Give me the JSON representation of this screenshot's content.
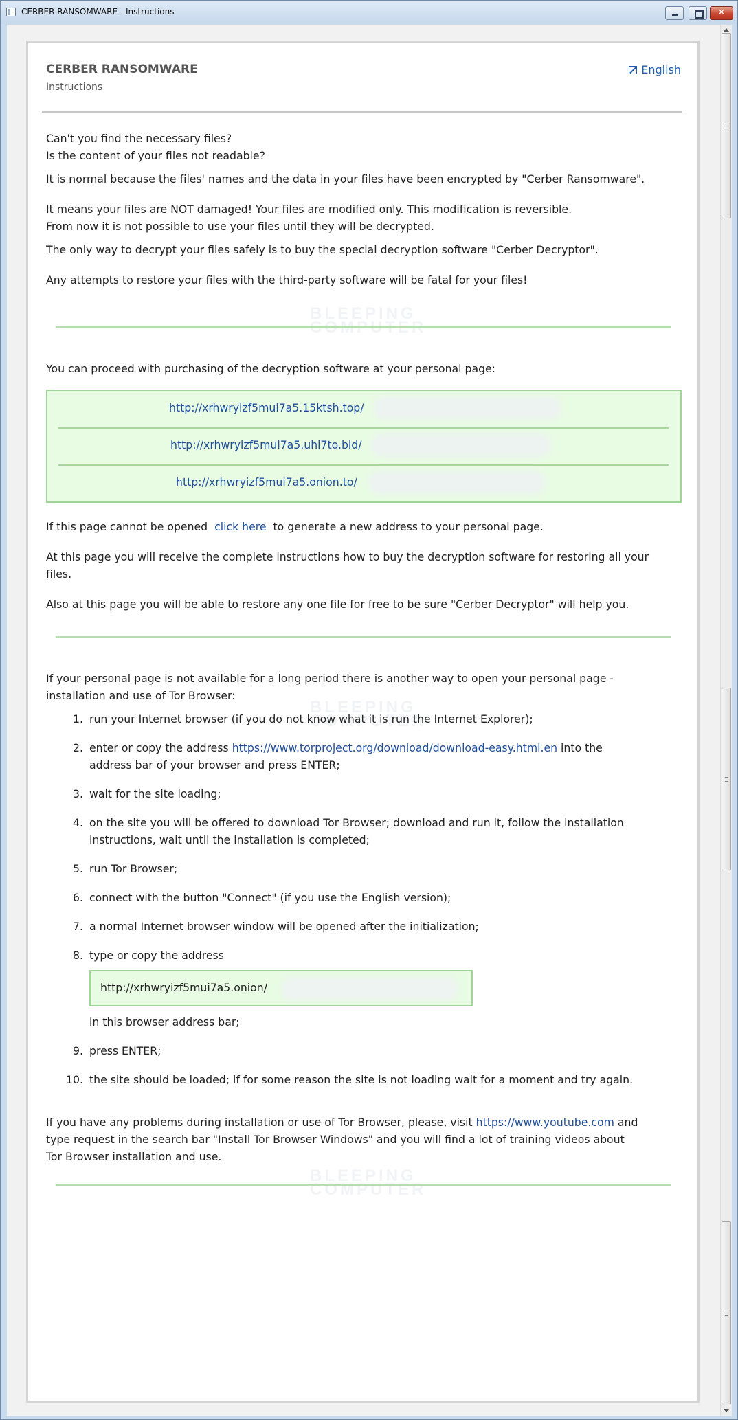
{
  "window": {
    "title": "CERBER RANSOMWARE - Instructions"
  },
  "header": {
    "title": "CERBER RANSOMWARE",
    "subtitle": "Instructions",
    "language": "English"
  },
  "intro": {
    "p1_line1": "Can't you find the necessary files?",
    "p1_line2": "Is the content of your files not readable?",
    "p2": "It is normal because the files' names and the data in your files have been encrypted by \"Cerber Ransomware\".",
    "p3_line1": "It means your files are NOT damaged! Your files are modified only. This modification is reversible.",
    "p3_line2": "From now it is not possible to use your files until they will be decrypted.",
    "p4": "The only way to decrypt your files safely is to buy the special decryption software \"Cerber Decryptor\".",
    "p5": "Any attempts to restore your files with the third-party software will be fatal for your files!"
  },
  "watermark": {
    "line1": "BLEEPING",
    "line2": "COMPUTER"
  },
  "purchase": {
    "intro": "You can proceed with purchasing of the decryption software at your personal page:",
    "urls": [
      "http://xrhwryizf5mui7a5.15ktsh.top/",
      "http://xrhwryizf5mui7a5.uhi7to.bid/",
      "http://xrhwryizf5mui7a5.onion.to/"
    ],
    "cannot_open_before": "If this page cannot be opened",
    "click_here": "click here",
    "cannot_open_after": "to generate a new address to your personal page.",
    "complete_line1": "At this page you will receive the complete instructions how to buy the decryption software for restoring all your",
    "complete_line2": "files.",
    "restore_free": "Also at this page you will be able to restore any one file for free to be sure \"Cerber Decryptor\" will help you."
  },
  "tor": {
    "intro_line1": "If your personal page is not available for a long period there is another way to open your personal page -",
    "intro_line2": "installation and use of Tor Browser:",
    "steps": [
      {
        "num": "1.",
        "text": "run your Internet browser (if you do not know what it is run the Internet Explorer);"
      },
      {
        "num": "2.",
        "before": "enter or copy the address",
        "link": "https://www.torproject.org/download/download-easy.html.en",
        "after": "into the",
        "line2": "address bar of your browser and press ENTER;"
      },
      {
        "num": "3.",
        "text": "wait for the site loading;"
      },
      {
        "num": "4.",
        "line1": "on the site you will be offered to download Tor Browser; download and run it, follow the installation",
        "line2": "instructions, wait until the installation is completed;"
      },
      {
        "num": "5.",
        "text": "run Tor Browser;"
      },
      {
        "num": "6.",
        "text": "connect with the button \"Connect\" (if you use the English version);"
      },
      {
        "num": "7.",
        "text": "a normal Internet browser window will be opened after the initialization;"
      },
      {
        "num": "8.",
        "text": "type or copy the address",
        "onion": "http://xrhwryizf5mui7a5.onion/",
        "after": "in this browser address bar;"
      },
      {
        "num": "9.",
        "text": "press ENTER;"
      },
      {
        "num": "10.",
        "text": "the site should be loaded; if for some reason the site is not loading wait for a moment and try again."
      }
    ],
    "help_before": "If you have any problems during installation or use of Tor Browser, please, visit",
    "help_link": "https://www.youtube.com",
    "help_after": "and",
    "help_line2": "type request in the search bar \"Install Tor Browser Windows\" and you will find a lot of training videos about",
    "help_line3": "Tor Browser installation and use."
  },
  "colors": {
    "link": "#1f4f9c",
    "box_bg": "#e8fbe3",
    "box_border": "#9fd596",
    "divider_green": "#b8dcb2"
  }
}
